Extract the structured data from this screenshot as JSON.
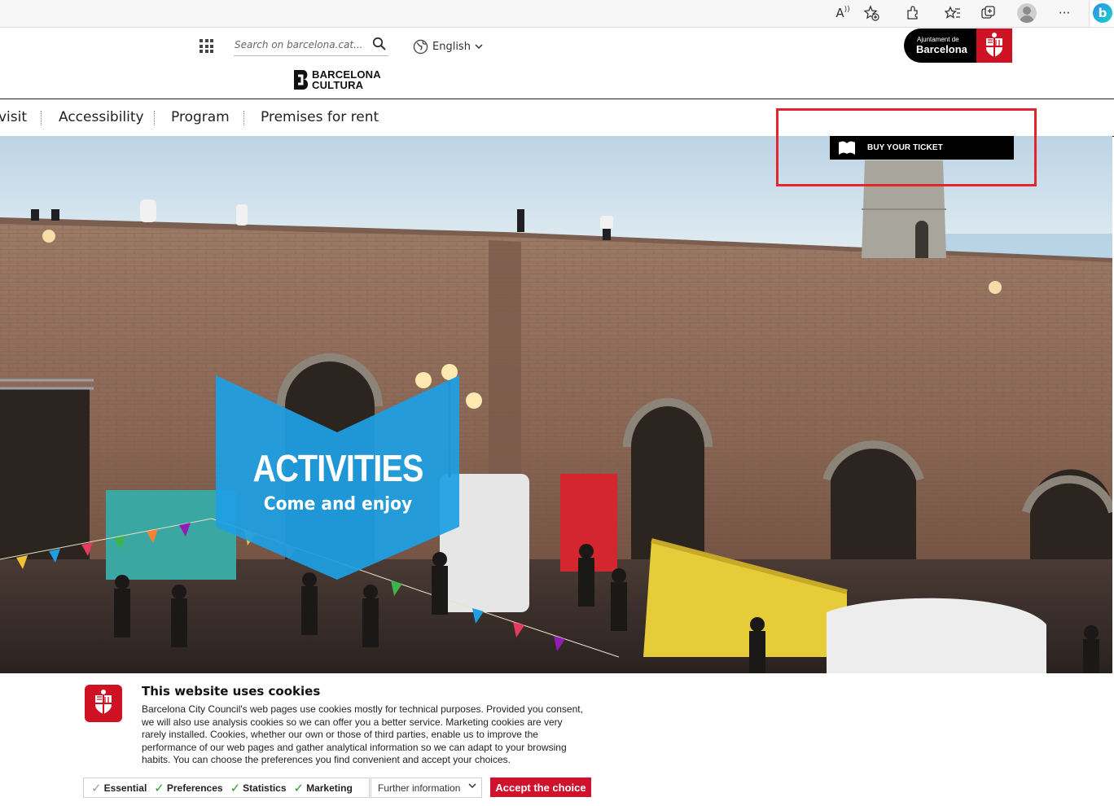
{
  "browser": {
    "toolbar_icons": [
      "read-aloud-icon",
      "add-favorite-icon",
      "extensions-icon",
      "favorites-icon",
      "collections-icon",
      "profile-icon",
      "more-icon",
      "bing-icon"
    ],
    "read_aloud_glyph": "A",
    "more_glyph": "···",
    "bing_glyph": "b"
  },
  "header": {
    "search": {
      "placeholder": "Search on barcelona.cat..."
    },
    "language": {
      "selected": "English"
    },
    "logo": {
      "line1": "BARCELONA",
      "line2": "CULTURA"
    },
    "council": {
      "line1": "Ajuntament de",
      "line2": "Barcelona"
    }
  },
  "nav": {
    "items": [
      "visit",
      "Accessibility",
      "Program",
      "Premises for rent"
    ]
  },
  "hero": {
    "buy_ticket": "BUY YOUR TICKET",
    "banner_title": "ACTIVITIES",
    "banner_subtitle": "Come and enjoy",
    "banner_color": "#1e9fe3",
    "highlight_color": "#e1262e"
  },
  "cookie": {
    "title": "This website uses cookies",
    "text": "Barcelona City Council's web pages use cookies mostly for technical purposes. Provided you consent, we will also use analysis cookies so we can offer you a better service. Marketing cookies are very rarely installed. Cookies, whether our own or those of third parties, enable us to improve the performance of our web pages and gather analytical information so we can adapt to your browsing habits. You can choose the preferences you find convenient and accept your choices.",
    "options": [
      "Essential",
      "Preferences",
      "Statistics",
      "Marketing"
    ],
    "further_info": "Further information",
    "accept": "Accept the choice",
    "brand_red": "#d0112b"
  }
}
